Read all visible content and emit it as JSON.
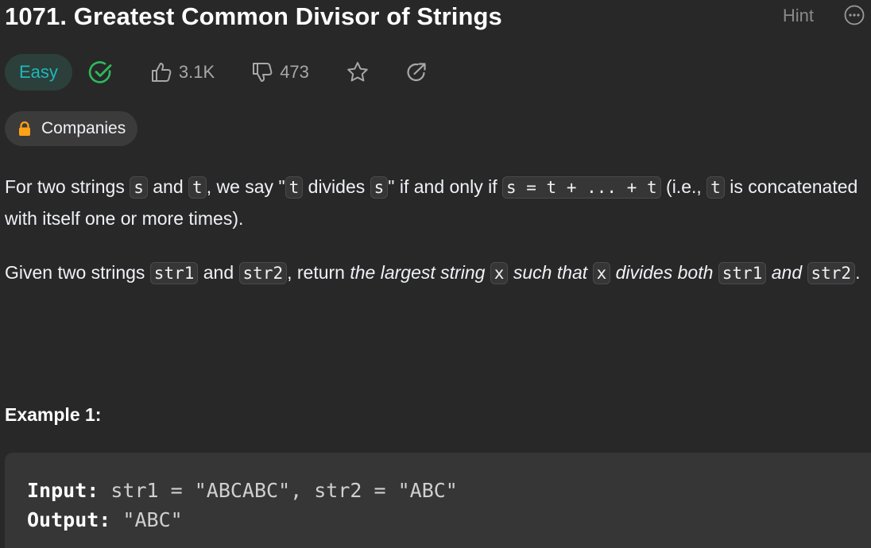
{
  "problem": {
    "title": "1071. Greatest Common Divisor of Strings",
    "hint_label": "Hint",
    "difficulty": "Easy",
    "likes": "3.1K",
    "dislikes": "473",
    "companies_label": "Companies"
  },
  "description": {
    "p1": {
      "t1": "For two strings ",
      "c1": "s",
      "t2": " and ",
      "c2": "t",
      "t3": ", we say \"",
      "c3": "t",
      "t4": " divides ",
      "c4": "s",
      "t5": "\" if and only if ",
      "c5": "s = t + ... + t",
      "t6": " (i.e., ",
      "c6": "t",
      "t7": " is concatenated with itself one or more times)."
    },
    "p2": {
      "t1": "Given two strings ",
      "c1": "str1",
      "t2": " and ",
      "c2": "str2",
      "t3": ", return ",
      "e1": "the largest string ",
      "c3": "x",
      "e2": " such that ",
      "c4": "x",
      "e3": " divides both ",
      "c5": "str1",
      "e4": " and ",
      "c6": "str2",
      "t4": "."
    }
  },
  "example1": {
    "title": "Example 1:",
    "input_label": "Input:",
    "input_value": " str1 = \"ABCABC\", str2 = \"ABC\"",
    "output_label": "Output:",
    "output_value": " \"ABC\""
  },
  "colors": {
    "background": "#282828",
    "easy": "#1cb8b8",
    "solved": "#2cbb5d",
    "lock": "#ffa116"
  },
  "icons": [
    "more-icon",
    "solved-check-icon",
    "thumbs-up-icon",
    "thumbs-down-icon",
    "star-icon",
    "share-icon",
    "lock-icon"
  ]
}
